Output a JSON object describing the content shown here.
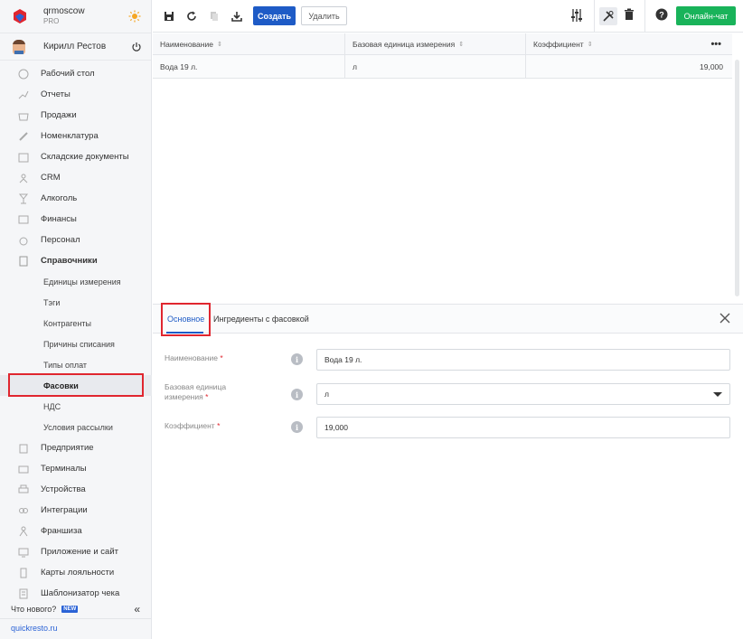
{
  "sidebar": {
    "brand_name": "qrmoscow",
    "brand_plan": "PRO",
    "user_name": "Кирилл Рестов",
    "menu": [
      {
        "label": "Рабочий стол",
        "icon": "dashboard-icon"
      },
      {
        "label": "Отчеты",
        "icon": "chart-icon"
      },
      {
        "label": "Продажи",
        "icon": "basket-icon"
      },
      {
        "label": "Номенклатура",
        "icon": "tag-icon"
      },
      {
        "label": "Складские документы",
        "icon": "folder-icon"
      },
      {
        "label": "CRM",
        "icon": "people-icon"
      },
      {
        "label": "Алкоголь",
        "icon": "glass-icon"
      },
      {
        "label": "Финансы",
        "icon": "wallet-icon"
      },
      {
        "label": "Персонал",
        "icon": "staff-icon"
      },
      {
        "label": "Справочники",
        "icon": "book-icon"
      }
    ],
    "submenu": [
      "Единицы измерения",
      "Тэги",
      "Контрагенты",
      "Причины списания",
      "Типы оплат",
      "Фасовки",
      "НДС",
      "Условия рассылки"
    ],
    "menu2": [
      {
        "label": "Предприятие",
        "icon": "building-icon"
      },
      {
        "label": "Терминалы",
        "icon": "terminal-icon"
      },
      {
        "label": "Устройства",
        "icon": "printer-icon"
      },
      {
        "label": "Интеграции",
        "icon": "link-icon"
      },
      {
        "label": "Франшиза",
        "icon": "network-icon"
      },
      {
        "label": "Приложение и сайт",
        "icon": "monitor-icon"
      },
      {
        "label": "Карты лояльности",
        "icon": "card-icon"
      },
      {
        "label": "Шаблонизатор чека",
        "icon": "receipt-icon"
      }
    ],
    "whats_new": "Что нового?",
    "new_badge": "NEW",
    "collapse": "«",
    "site": "quickresto.ru"
  },
  "toolbar": {
    "create_label": "Создать",
    "delete_label": "Удалить",
    "chat_label": "Онлайн-чат"
  },
  "grid": {
    "columns": [
      "Наименование",
      "Базовая единица измерения",
      "Коэффициент"
    ],
    "rows": [
      [
        "Вода 19 л.",
        "л",
        "19,000"
      ]
    ],
    "more": "•••",
    "sort_glyph": "⇕"
  },
  "panel": {
    "tabs": [
      "Основное",
      "Ингредиенты с фасовкой"
    ],
    "fields": [
      {
        "label": "Наименование",
        "value": "Вода 19 л."
      },
      {
        "label": "Базовая единица измерения",
        "value": "л"
      },
      {
        "label": "Коэффициент",
        "value": "19,000"
      }
    ],
    "required_mark": "*",
    "info_glyph": "i"
  },
  "colors": {
    "accent": "#1e5bc6",
    "chat": "#19b35a",
    "highlight": "#e0262f"
  }
}
